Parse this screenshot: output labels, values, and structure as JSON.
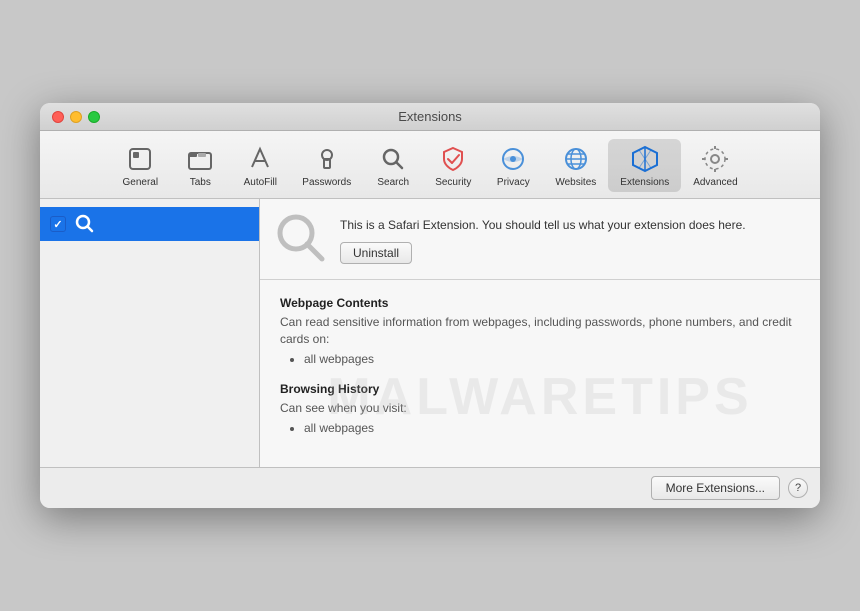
{
  "window": {
    "title": "Extensions"
  },
  "toolbar": {
    "items": [
      {
        "id": "general",
        "label": "General",
        "icon": "general"
      },
      {
        "id": "tabs",
        "label": "Tabs",
        "icon": "tabs"
      },
      {
        "id": "autofill",
        "label": "AutoFill",
        "icon": "autofill"
      },
      {
        "id": "passwords",
        "label": "Passwords",
        "icon": "passwords"
      },
      {
        "id": "search",
        "label": "Search",
        "icon": "search"
      },
      {
        "id": "security",
        "label": "Security",
        "icon": "security"
      },
      {
        "id": "privacy",
        "label": "Privacy",
        "icon": "privacy"
      },
      {
        "id": "websites",
        "label": "Websites",
        "icon": "websites"
      },
      {
        "id": "extensions",
        "label": "Extensions",
        "icon": "extensions",
        "active": true
      },
      {
        "id": "advanced",
        "label": "Advanced",
        "icon": "advanced"
      }
    ]
  },
  "sidebar": {
    "items": [
      {
        "id": "search-ext",
        "label": "",
        "checked": true,
        "selected": true
      }
    ]
  },
  "detail": {
    "description": "This is a Safari Extension. You should tell us what your extension does here.",
    "uninstall_label": "Uninstall",
    "permissions": [
      {
        "title": "Webpage Contents",
        "description": "Can read sensitive information from webpages, including passwords, phone numbers, and credit cards on:",
        "items": [
          "all webpages"
        ]
      },
      {
        "title": "Browsing History",
        "description": "Can see when you visit:",
        "items": [
          "all webpages"
        ]
      }
    ]
  },
  "bottom_bar": {
    "more_extensions_label": "More Extensions...",
    "help_label": "?"
  },
  "watermark": "MALWARETIPS"
}
